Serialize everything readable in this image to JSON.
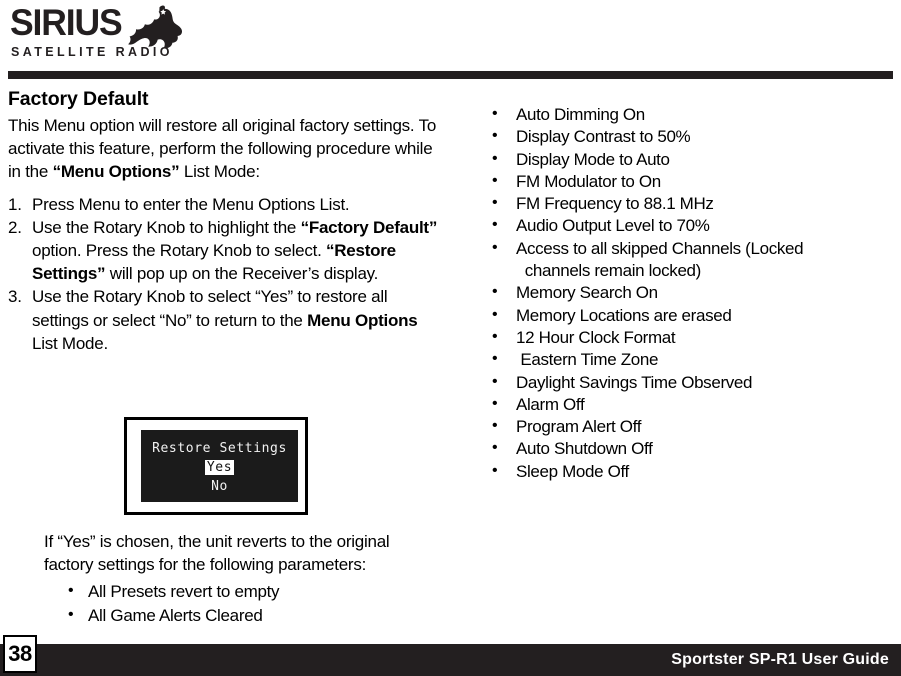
{
  "header": {
    "logo": {
      "wordmark": "SIRIUS",
      "tagline": "SATELLITE RADIO",
      "mascot_icon": "sirius-dog-icon"
    }
  },
  "main": {
    "section_title": "Factory Default",
    "intro_parts": [
      {
        "text": "This Menu option will restore all original factory settings. To activate this feature, perform the following procedure while in the ",
        "bold": false
      },
      {
        "text": "“Menu Options”",
        "bold": true
      },
      {
        "text": " List Mode:",
        "bold": false
      }
    ],
    "steps": [
      {
        "number": "1.",
        "parts": [
          {
            "text": "Press Menu to enter the Menu Options List.",
            "bold": false
          }
        ]
      },
      {
        "number": "2.",
        "parts": [
          {
            "text": "Use the Rotary Knob to highlight the ",
            "bold": false
          },
          {
            "text": "“Factory Default”",
            "bold": true
          },
          {
            "text": " option. Press the Rotary Knob to select. ",
            "bold": false
          },
          {
            "text": "“Restore  Settings”",
            "bold": true
          },
          {
            "text": " will pop up on the Receiver’s display.",
            "bold": false
          }
        ]
      },
      {
        "number": "3.",
        "parts": [
          {
            "text": "Use the Rotary Knob to select “Yes” to restore all settings or select “No” to return to the ",
            "bold": false
          },
          {
            "text": "Menu Options",
            "bold": true
          },
          {
            "text": " List Mode.",
            "bold": false
          }
        ]
      }
    ],
    "lcd": {
      "title": "Restore Settings",
      "option_yes": "Yes",
      "option_no": "No",
      "selected": "Yes"
    },
    "caption": "If “Yes” is chosen, the unit reverts to the original factory settings for the following parameters:",
    "bullet_glyph": "•",
    "sub_bullets": [
      "All Presets revert to empty",
      "All Game Alerts Cleared"
    ],
    "defaults": [
      "Auto Dimming On",
      "Display Contrast to 50%",
      "Display Mode to Auto",
      "FM Modulator to On",
      "FM Frequency to 88.1 MHz",
      "Audio Output Level to 70%",
      "Access to all skipped Channels (Locked\n  channels remain locked)",
      "Memory Search On",
      "Memory Locations are erased",
      "12 Hour Clock Format",
      " Eastern Time Zone",
      "Daylight Savings Time Observed",
      "Alarm Off",
      "Program Alert Off",
      "Auto Shutdown Off",
      "Sleep Mode Off"
    ]
  },
  "footer": {
    "page_number": "38",
    "guide_title": "Sportster SP-R1 User Guide"
  },
  "colors": {
    "ink": "#231f20",
    "lcd_background": "#1b1b1b",
    "lcd_text": "#f2f2f2"
  }
}
